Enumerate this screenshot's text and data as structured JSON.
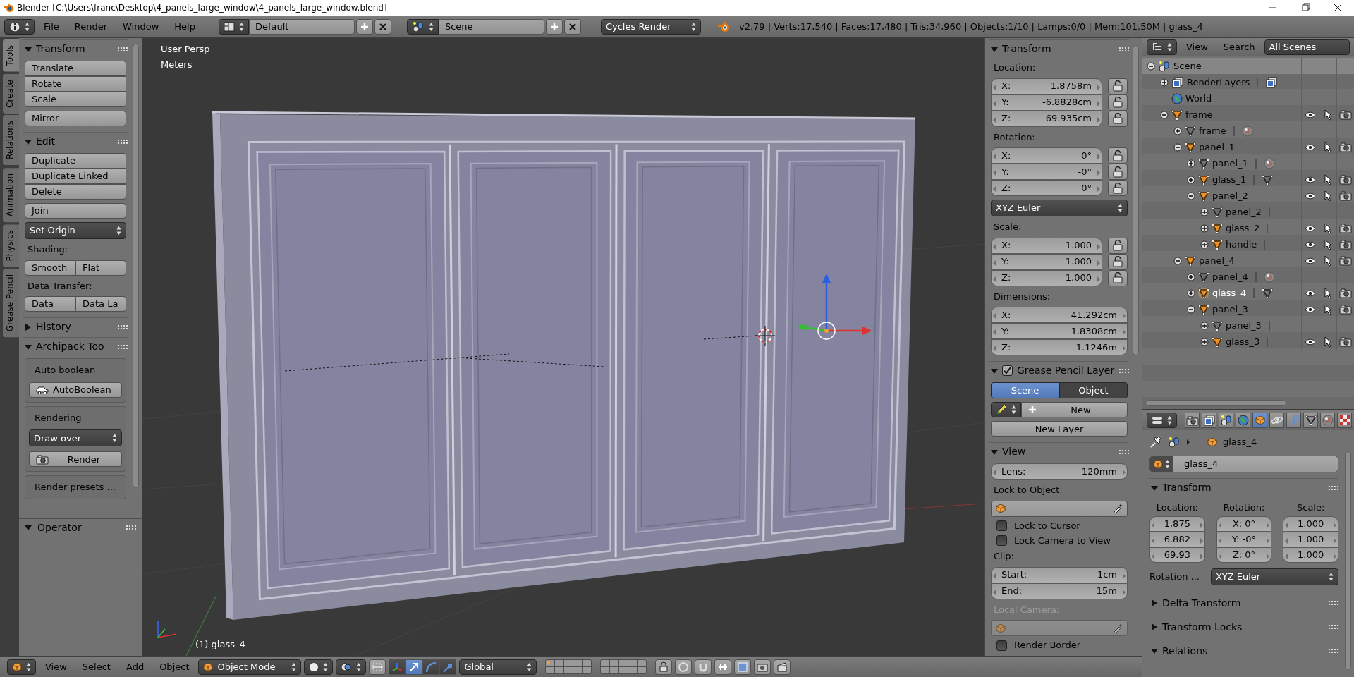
{
  "window": {
    "title": "Blender [C:\\Users\\franc\\Desktop\\4_panels_large_window\\4_panels_large_window.blend]"
  },
  "header": {
    "menus": [
      "File",
      "Render",
      "Window",
      "Help"
    ],
    "layout": "Default",
    "scene": "Scene",
    "engine": "Cycles Render",
    "stats": "v2.79 | Verts:17,540 | Faces:17,480 | Tris:34,960 | Objects:1/10 | Lamps:0/0 | Mem:101.50M | glass_4"
  },
  "tool_tabs": [
    {
      "label": "Tools",
      "selected": true
    },
    {
      "label": "Create",
      "selected": false
    },
    {
      "label": "Relations",
      "selected": false
    },
    {
      "label": "Animation",
      "selected": false
    },
    {
      "label": "Physics",
      "selected": false
    },
    {
      "label": "Grease Pencil",
      "selected": false
    }
  ],
  "tool_shelf": [
    {
      "title": "Transform",
      "expanded": true,
      "items": [
        {
          "kind": "column",
          "labels": [
            "Translate",
            "Rotate",
            "Scale"
          ]
        },
        {
          "kind": "button",
          "label": "Mirror"
        }
      ]
    },
    {
      "title": "Edit",
      "expanded": true,
      "items": [
        {
          "kind": "column",
          "labels": [
            "Duplicate",
            "Duplicate Linked",
            "Delete"
          ]
        },
        {
          "kind": "button",
          "label": "Join"
        },
        {
          "kind": "dropdown",
          "label": "Set Origin"
        },
        {
          "kind": "label",
          "label": "Shading:"
        },
        {
          "kind": "row",
          "labels": [
            "Smooth",
            "Flat"
          ]
        },
        {
          "kind": "label",
          "label": "Data Transfer:"
        },
        {
          "kind": "row",
          "labels": [
            "Data",
            "Data La"
          ]
        }
      ]
    },
    {
      "title": "History",
      "expanded": false
    },
    {
      "title": "Archipack Too",
      "expanded": true,
      "items": [
        {
          "kind": "box",
          "items": [
            {
              "kind": "label",
              "label": "Auto boolean"
            },
            {
              "kind": "carbutton",
              "label": "AutoBoolean"
            }
          ]
        },
        {
          "kind": "box",
          "items": [
            {
              "kind": "label",
              "label": "Rendering"
            },
            {
              "kind": "dropdown",
              "label": "Draw over"
            },
            {
              "kind": "camerabutton",
              "label": "Render"
            }
          ]
        },
        {
          "kind": "box",
          "items": [
            {
              "kind": "label",
              "label": "Render presets ..."
            }
          ]
        }
      ]
    }
  ],
  "operator": {
    "title": "Operator",
    "expanded": true
  },
  "viewport": {
    "view": "User Persp",
    "units": "Meters",
    "object": "(1) glass_4"
  },
  "n_panel": [
    {
      "title": "Transform",
      "expanded": true,
      "items": [
        {
          "kind": "label",
          "label": "Location:",
          "disabled": false
        },
        {
          "kind": "vector",
          "fields": [
            {
              "axis": "X:",
              "value": "1.8758m",
              "locked": false
            },
            {
              "axis": "Y:",
              "value": "-6.8828cm",
              "locked": false
            },
            {
              "axis": "Z:",
              "value": "69.935cm",
              "locked": false
            }
          ]
        },
        {
          "kind": "label",
          "label": "Rotation:",
          "disabled": false
        },
        {
          "kind": "vector",
          "fields": [
            {
              "axis": "X:",
              "value": "0°",
              "locked": false
            },
            {
              "axis": "Y:",
              "value": "-0°",
              "locked": false
            },
            {
              "axis": "Z:",
              "value": "0°",
              "locked": false
            }
          ]
        },
        {
          "kind": "dropdown",
          "label": "XYZ Euler"
        },
        {
          "kind": "label",
          "label": "Scale:",
          "disabled": false
        },
        {
          "kind": "vector",
          "fields": [
            {
              "axis": "X:",
              "value": "1.000",
              "locked": false
            },
            {
              "axis": "Y:",
              "value": "1.000",
              "locked": false
            },
            {
              "axis": "Z:",
              "value": "1.000",
              "locked": false
            }
          ]
        },
        {
          "kind": "label",
          "label": "Dimensions:",
          "disabled": false
        },
        {
          "kind": "vector",
          "fields": [
            {
              "axis": "X:",
              "value": "41.292cm"
            },
            {
              "axis": "Y:",
              "value": "1.8308cm"
            },
            {
              "axis": "Z:",
              "value": "1.1246m"
            }
          ]
        }
      ]
    },
    {
      "title": "Grease Pencil Layer",
      "expanded": true,
      "checked": true,
      "items": [
        {
          "kind": "tabs",
          "tabs": [
            {
              "label": "Scene",
              "selected": true
            },
            {
              "label": "Object",
              "selected": false
            }
          ]
        },
        {
          "kind": "newbutton",
          "label": "New"
        },
        {
          "kind": "button",
          "label": "New Layer"
        }
      ]
    },
    {
      "title": "View",
      "expanded": true,
      "items": [
        {
          "kind": "vector",
          "fields": [
            {
              "axis": "Lens:",
              "value": "120mm"
            }
          ]
        },
        {
          "kind": "label",
          "label": "Lock to Object:",
          "disabled": false
        },
        {
          "kind": "objectfield",
          "disabled": false
        },
        {
          "kind": "checkbox",
          "label": "Lock to Cursor",
          "checked": false
        },
        {
          "kind": "checkbox",
          "label": "Lock Camera to View",
          "checked": false
        },
        {
          "kind": "label",
          "label": "Clip:",
          "disabled": false
        },
        {
          "kind": "vector",
          "fields": [
            {
              "axis": "Start:",
              "value": "1cm"
            },
            {
              "axis": "End:",
              "value": "15m"
            }
          ]
        },
        {
          "kind": "label",
          "label": "Local Camera:",
          "disabled": true
        },
        {
          "kind": "objectfield",
          "disabled": true
        },
        {
          "kind": "checkbox",
          "label": "Render Border",
          "checked": false
        }
      ]
    }
  ],
  "outliner": {
    "menus": [
      "View",
      "Search"
    ],
    "display": "All Scenes",
    "tree": [
      {
        "label": "Scene",
        "kind": "scene",
        "expanded": true,
        "selected": false,
        "children": [
          {
            "label": "RenderLayers",
            "kind": "renderlayers",
            "expanded": false,
            "selected": false,
            "collapsed": [
              {
                "kind": "renderlayers"
              }
            ]
          },
          {
            "label": "World",
            "kind": "world",
            "selected": false
          },
          {
            "label": "frame",
            "kind": "object",
            "expanded": true,
            "selected": false,
            "children": [
              {
                "label": "frame",
                "kind": "mesh",
                "expanded": false,
                "selected": false,
                "collapsed": [
                  {
                    "kind": "material"
                  }
                ]
              },
              {
                "label": "panel_1",
                "kind": "object",
                "expanded": true,
                "selected": false,
                "children": [
                  {
                    "label": "panel_1",
                    "kind": "mesh",
                    "expanded": false,
                    "selected": false,
                    "collapsed": [
                      {
                        "kind": "material"
                      }
                    ]
                  },
                  {
                    "label": "glass_1",
                    "kind": "object",
                    "expanded": false,
                    "selected": false,
                    "collapsed": [
                      {
                        "kind": "mesh"
                      }
                    ]
                  },
                  {
                    "label": "panel_2",
                    "kind": "object",
                    "expanded": true,
                    "selected": false,
                    "children": [
                      {
                        "label": "panel_2",
                        "kind": "mesh",
                        "expanded": false,
                        "selected": false
                      },
                      {
                        "label": "glass_2",
                        "kind": "object",
                        "expanded": false,
                        "selected": false
                      },
                      {
                        "label": "handle",
                        "kind": "object",
                        "expanded": false,
                        "selected": false
                      }
                    ]
                  }
                ]
              },
              {
                "label": "panel_4",
                "kind": "object",
                "expanded": true,
                "selected": false,
                "children": [
                  {
                    "label": "panel_4",
                    "kind": "mesh",
                    "expanded": false,
                    "selected": false,
                    "collapsed": [
                      {
                        "kind": "material"
                      }
                    ]
                  },
                  {
                    "label": "glass_4",
                    "kind": "object",
                    "expanded": false,
                    "selected": true,
                    "collapsed": [
                      {
                        "kind": "mesh"
                      }
                    ]
                  },
                  {
                    "label": "panel_3",
                    "kind": "object",
                    "expanded": true,
                    "selected": false,
                    "children": [
                      {
                        "label": "panel_3",
                        "kind": "mesh",
                        "expanded": false,
                        "selected": false
                      },
                      {
                        "label": "glass_3",
                        "kind": "object",
                        "expanded": false,
                        "selected": false
                      }
                    ]
                  }
                ]
              }
            ]
          }
        ]
      }
    ]
  },
  "properties": {
    "tabs": [
      {
        "kind": "render",
        "selected": false
      },
      {
        "kind": "renderlayers",
        "selected": false
      },
      {
        "kind": "scene",
        "selected": false
      },
      {
        "kind": "world",
        "selected": false
      },
      {
        "kind": "object",
        "selected": true
      },
      {
        "kind": "constraints",
        "selected": false
      },
      {
        "kind": "modifiers",
        "selected": false
      },
      {
        "kind": "data",
        "selected": false
      },
      {
        "kind": "material",
        "selected": false
      },
      {
        "kind": "texture",
        "selected": false
      }
    ],
    "breadcrumb": "glass_4",
    "object_name": "glass_4",
    "panels": [
      {
        "title": "Transform",
        "expanded": true,
        "columns": [
          {
            "label": "Location:",
            "fields": [
              {
                "value": "1.875"
              },
              {
                "value": "6.882"
              },
              {
                "value": "69.93"
              }
            ]
          },
          {
            "label": "Rotation:",
            "fields": [
              {
                "axis": "X:",
                "value": "0°"
              },
              {
                "axis": "Y:",
                "value": "-0°"
              },
              {
                "axis": "Z:",
                "value": "0°"
              }
            ]
          },
          {
            "label": "Scale:",
            "fields": [
              {
                "value": "1.000"
              },
              {
                "value": "1.000"
              },
              {
                "value": "1.000"
              }
            ]
          }
        ],
        "mode_label": "Rotation ...",
        "mode": "XYZ Euler"
      },
      {
        "title": "Delta Transform",
        "expanded": false
      },
      {
        "title": "Transform Locks",
        "expanded": false
      },
      {
        "title": "Relations",
        "expanded": true
      }
    ]
  },
  "bottom_bar": {
    "menus": [
      "View",
      "Select",
      "Add",
      "Object"
    ],
    "mode": "Object Mode",
    "manipulators": [
      {
        "kind": "toggle",
        "selected": false
      },
      {
        "kind": "translate",
        "selected": true
      },
      {
        "kind": "rotate",
        "selected": false
      },
      {
        "kind": "scale",
        "selected": false
      }
    ],
    "orientation": "Global"
  }
}
